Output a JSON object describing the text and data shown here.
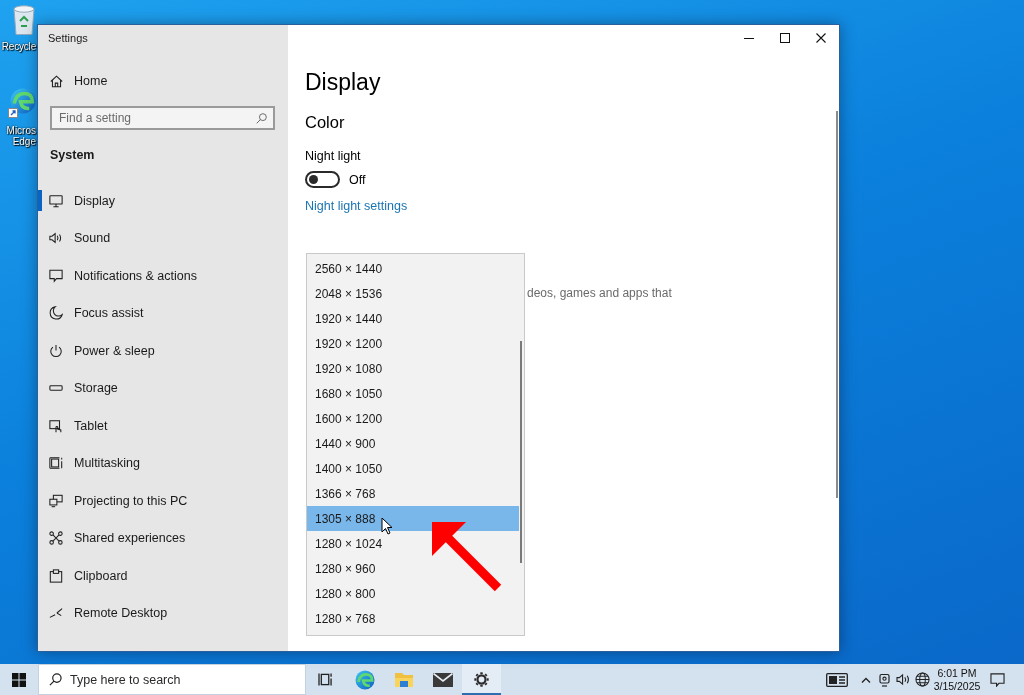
{
  "desktop": {
    "icons": [
      {
        "kind": "recycle-bin",
        "lines": [
          "Recycle"
        ]
      },
      {
        "kind": "browser",
        "lines": [
          "Micros",
          "Edge"
        ]
      }
    ]
  },
  "window": {
    "title": "Settings",
    "controls": [
      {
        "kind": "minimize"
      },
      {
        "kind": "maximize"
      },
      {
        "kind": "close"
      }
    ]
  },
  "sidebar": {
    "home": "Home",
    "search": {
      "placeholder": "Find a setting"
    },
    "section": "System",
    "items": [
      {
        "kind": "display",
        "label": "Display",
        "selected": true
      },
      {
        "kind": "sound",
        "label": "Sound",
        "selected": false
      },
      {
        "kind": "notifications",
        "label": "Notifications & actions",
        "selected": false
      },
      {
        "kind": "focus",
        "label": "Focus assist",
        "selected": false
      },
      {
        "kind": "power",
        "label": "Power & sleep",
        "selected": false
      },
      {
        "kind": "storage",
        "label": "Storage",
        "selected": false
      },
      {
        "kind": "tablet",
        "label": "Tablet",
        "selected": false
      },
      {
        "kind": "multitasking",
        "label": "Multitasking",
        "selected": false
      },
      {
        "kind": "projecting",
        "label": "Projecting to this PC",
        "selected": false
      },
      {
        "kind": "shared",
        "label": "Shared experiences",
        "selected": false
      },
      {
        "kind": "clipboard",
        "label": "Clipboard",
        "selected": false
      },
      {
        "kind": "remote",
        "label": "Remote Desktop",
        "selected": false
      }
    ]
  },
  "page": {
    "heading": "Display",
    "section": "Color",
    "night_light": {
      "label": "Night light",
      "on": false,
      "state_text": "Off"
    },
    "link": "Night light settings",
    "partial_text": "deos, games and apps that"
  },
  "dropdown": {
    "options": [
      {
        "label": "2560 × 1440",
        "selected": false
      },
      {
        "label": "2048 × 1536",
        "selected": false
      },
      {
        "label": "1920 × 1440",
        "selected": false
      },
      {
        "label": "1920 × 1200",
        "selected": false
      },
      {
        "label": "1920 × 1080",
        "selected": false
      },
      {
        "label": "1680 × 1050",
        "selected": false
      },
      {
        "label": "1600 × 1200",
        "selected": false
      },
      {
        "label": "1440 × 900",
        "selected": false
      },
      {
        "label": "1400 × 1050",
        "selected": false
      },
      {
        "label": "1366 × 768",
        "selected": false
      },
      {
        "label": "1305 × 888",
        "selected": true
      },
      {
        "label": "1280 × 1024",
        "selected": false
      },
      {
        "label": "1280 × 960",
        "selected": false
      },
      {
        "label": "1280 × 800",
        "selected": false
      },
      {
        "label": "1280 × 768",
        "selected": false
      }
    ]
  },
  "taskbar": {
    "search": {
      "placeholder": "Type here to search"
    },
    "apps": [
      {
        "kind": "task-view",
        "active": false
      },
      {
        "kind": "browser",
        "active": false
      },
      {
        "kind": "explorer",
        "active": false
      },
      {
        "kind": "mail",
        "active": false
      },
      {
        "kind": "settings",
        "active": true
      }
    ],
    "tray": [
      {
        "kind": "news"
      },
      {
        "kind": "chevron"
      },
      {
        "kind": "meet"
      },
      {
        "kind": "volume"
      },
      {
        "kind": "network"
      }
    ],
    "clock": {
      "time": "6:01 PM",
      "date": "3/15/2025"
    }
  }
}
